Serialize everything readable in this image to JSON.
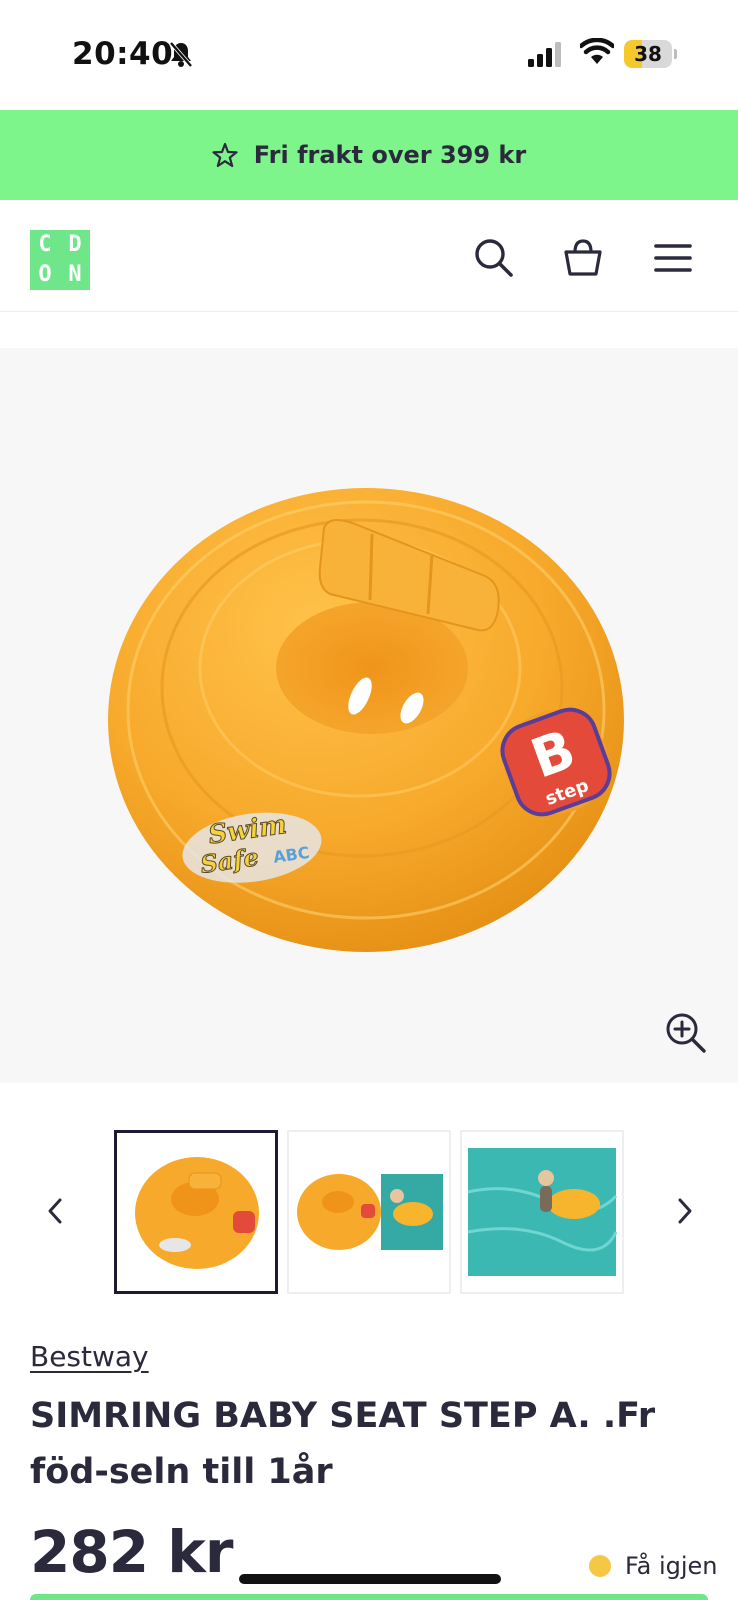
{
  "status_bar": {
    "time": "20:40",
    "battery_level": "38",
    "battery_fraction": 0.38,
    "icons": [
      "bell-slash-icon",
      "cellular-signal-icon",
      "wifi-icon",
      "battery-icon"
    ]
  },
  "promo": {
    "icon": "star-icon",
    "text": "Fri frakt over 399 kr"
  },
  "header": {
    "logo_letters": [
      "C",
      "D",
      "O",
      "N"
    ],
    "brand_color": "#6fe68a",
    "icons": [
      "search-icon",
      "basket-icon",
      "menu-icon"
    ]
  },
  "gallery": {
    "zoom_icon": "zoom-in-icon",
    "prev_icon": "chevron-left-icon",
    "next_icon": "chevron-right-icon",
    "selected_index": 0,
    "thumbnails": [
      "swim-ring-product",
      "swim-ring-with-baby-inset",
      "baby-in-pool-photo"
    ],
    "product_image_text": {
      "logo_line1": "Swim",
      "logo_line2": "Safe",
      "logo_letters": "ABC",
      "badge_text": "step",
      "badge_letter": "B"
    }
  },
  "product": {
    "brand": "Bestway",
    "title": "SIMRING BABY SEAT STEP A. .Fr föd-seln till 1år",
    "price": "282 kr",
    "stock_status": "Få igjen",
    "stock_color": "#f5c745"
  },
  "colors": {
    "promo_bar": "#7ef58b",
    "text_dark": "#2b2a3c",
    "ring_orange": "#f7a92b"
  }
}
